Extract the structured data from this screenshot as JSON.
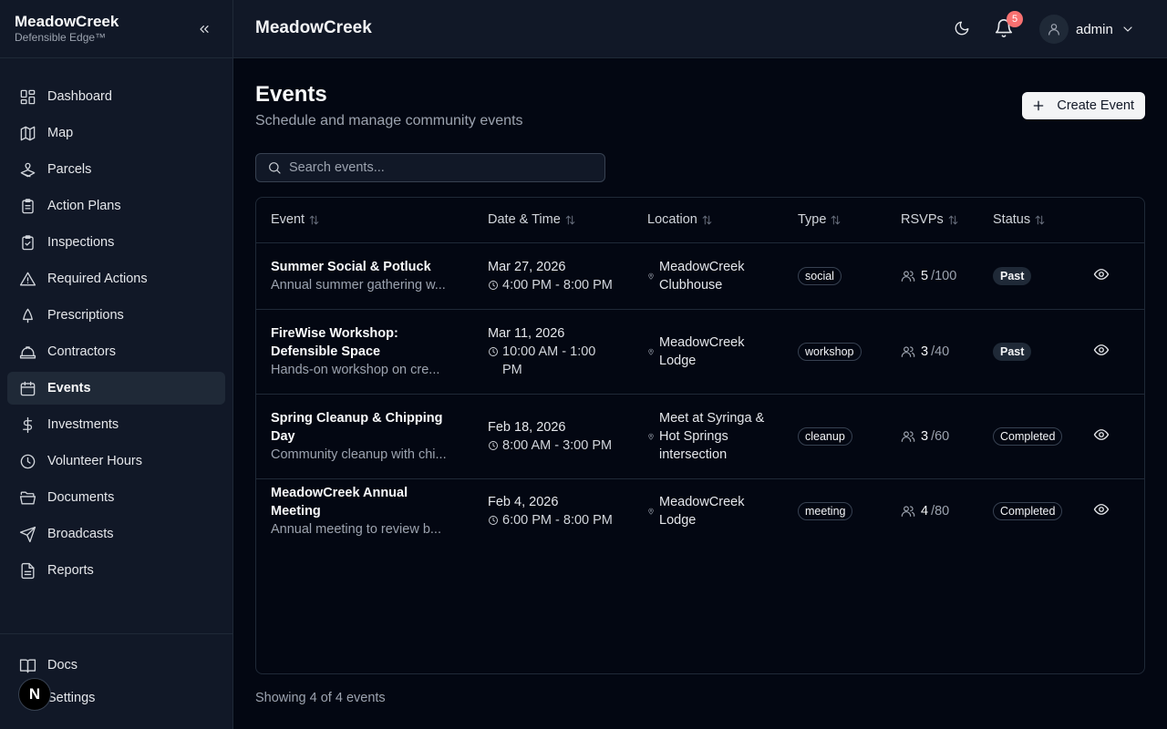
{
  "brand": {
    "name": "MeadowCreek",
    "tagline": "Defensible Edge™"
  },
  "sidebar": {
    "items": [
      {
        "label": "Dashboard",
        "icon": "dashboard-icon"
      },
      {
        "label": "Map",
        "icon": "map-icon"
      },
      {
        "label": "Parcels",
        "icon": "parcels-icon"
      },
      {
        "label": "Action Plans",
        "icon": "clipboard-list-icon"
      },
      {
        "label": "Inspections",
        "icon": "clipboard-check-icon"
      },
      {
        "label": "Required Actions",
        "icon": "warning-icon"
      },
      {
        "label": "Prescriptions",
        "icon": "tree-icon"
      },
      {
        "label": "Contractors",
        "icon": "hard-hat-icon"
      },
      {
        "label": "Events",
        "icon": "calendar-icon",
        "active": true
      },
      {
        "label": "Investments",
        "icon": "dollar-icon"
      },
      {
        "label": "Volunteer Hours",
        "icon": "clock-icon"
      },
      {
        "label": "Documents",
        "icon": "folder-icon"
      },
      {
        "label": "Broadcasts",
        "icon": "send-icon"
      },
      {
        "label": "Reports",
        "icon": "file-icon"
      }
    ],
    "footer": [
      {
        "label": "Docs",
        "icon": "book-icon"
      },
      {
        "label": "Settings",
        "icon": "gear-icon"
      }
    ],
    "badge_letter": "N"
  },
  "topbar": {
    "title": "MeadowCreek",
    "notifications": "5",
    "user": "admin"
  },
  "page": {
    "title": "Events",
    "subtitle": "Schedule and manage community events",
    "create_label": "Create Event",
    "search_placeholder": "Search events...",
    "footer": "Showing 4 of 4 events"
  },
  "table": {
    "columns": [
      "Event",
      "Date & Time",
      "Location",
      "Type",
      "RSVPs",
      "Status"
    ],
    "rows": [
      {
        "title": "Summer Social & Potluck",
        "desc": "Annual summer gathering w...",
        "date": "Mar 27, 2026",
        "time": "4:00 PM - 8:00 PM",
        "location": "MeadowCreek Clubhouse",
        "type": "social",
        "rsvp_count": "5",
        "rsvp_cap": "/100",
        "status": "Past"
      },
      {
        "title": "FireWise Workshop: Defensible Space",
        "desc": "Hands-on workshop on cre...",
        "date": "Mar 11, 2026",
        "time": "10:00 AM - 1:00 PM",
        "location": "MeadowCreek Lodge",
        "type": "workshop",
        "rsvp_count": "3",
        "rsvp_cap": "/40",
        "status": "Past"
      },
      {
        "title": "Spring Cleanup & Chipping Day",
        "desc": "Community cleanup with chi...",
        "date": "Feb 18, 2026",
        "time": "8:00 AM - 3:00 PM",
        "location": "Meet at Syringa & Hot Springs intersection",
        "type": "cleanup",
        "rsvp_count": "3",
        "rsvp_cap": "/60",
        "status": "Completed"
      },
      {
        "title": "MeadowCreek Annual Meeting",
        "desc": "Annual meeting to review b...",
        "date": "Feb 4, 2026",
        "time": "6:00 PM - 8:00 PM",
        "location": "MeadowCreek Lodge",
        "type": "meeting",
        "rsvp_count": "4",
        "rsvp_cap": "/80",
        "status": "Completed"
      }
    ]
  }
}
